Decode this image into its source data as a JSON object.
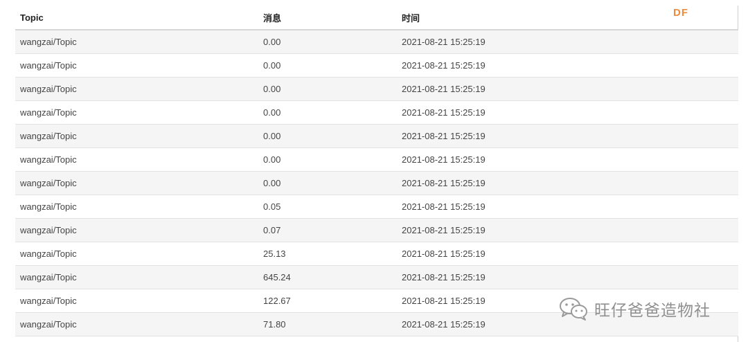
{
  "table": {
    "headers": [
      "Topic",
      "消息",
      "时间"
    ],
    "rows": [
      {
        "topic": "wangzai/Topic",
        "message": "0.00",
        "time": "2021-08-21 15:25:19"
      },
      {
        "topic": "wangzai/Topic",
        "message": "0.00",
        "time": "2021-08-21 15:25:19"
      },
      {
        "topic": "wangzai/Topic",
        "message": "0.00",
        "time": "2021-08-21 15:25:19"
      },
      {
        "topic": "wangzai/Topic",
        "message": "0.00",
        "time": "2021-08-21 15:25:19"
      },
      {
        "topic": "wangzai/Topic",
        "message": "0.00",
        "time": "2021-08-21 15:25:19"
      },
      {
        "topic": "wangzai/Topic",
        "message": "0.00",
        "time": "2021-08-21 15:25:19"
      },
      {
        "topic": "wangzai/Topic",
        "message": "0.00",
        "time": "2021-08-21 15:25:19"
      },
      {
        "topic": "wangzai/Topic",
        "message": "0.05",
        "time": "2021-08-21 15:25:19"
      },
      {
        "topic": "wangzai/Topic",
        "message": "0.07",
        "time": "2021-08-21 15:25:19"
      },
      {
        "topic": "wangzai/Topic",
        "message": "25.13",
        "time": "2021-08-21 15:25:19"
      },
      {
        "topic": "wangzai/Topic",
        "message": "645.24",
        "time": "2021-08-21 15:25:19"
      },
      {
        "topic": "wangzai/Topic",
        "message": "122.67",
        "time": "2021-08-21 15:25:19"
      },
      {
        "topic": "wangzai/Topic",
        "message": "71.80",
        "time": "2021-08-21 15:25:19"
      }
    ]
  },
  "logo": {
    "text": "DF",
    "color": "#f08a3c"
  },
  "watermark": {
    "icon": "wechat-icon",
    "text": "旺仔爸爸造物社"
  }
}
